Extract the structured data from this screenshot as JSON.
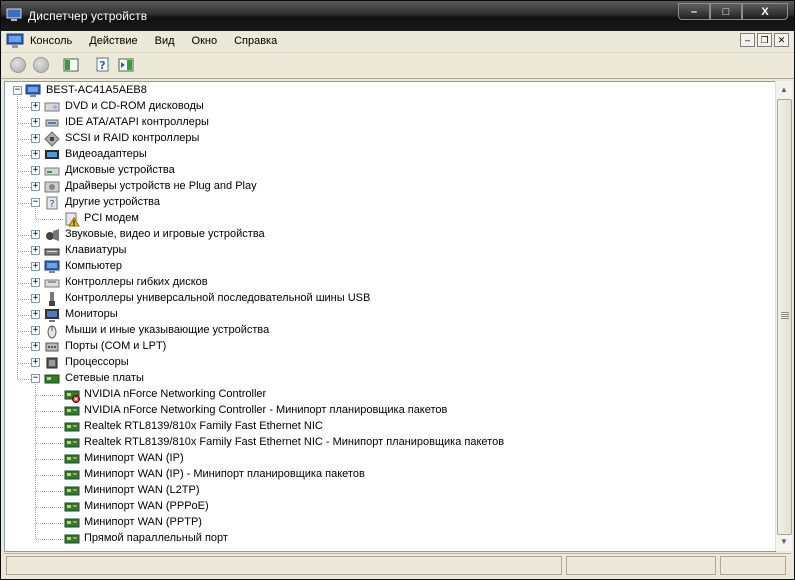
{
  "window": {
    "title": "Диспетчер устройств",
    "buttons": {
      "minimize": "–",
      "maximize": "□",
      "close": "X"
    }
  },
  "menu": {
    "items": [
      "Консоль",
      "Действие",
      "Вид",
      "Окно",
      "Справка"
    ]
  },
  "tree": {
    "root": "BEST-AC41A5AEB8",
    "items": [
      {
        "label": "DVD и CD-ROM дисководы",
        "level": 1,
        "expander": "+",
        "icon": "cdrom-icon"
      },
      {
        "label": "IDE ATA/ATAPI контроллеры",
        "level": 1,
        "expander": "+",
        "icon": "ide-controller-icon"
      },
      {
        "label": "SCSI и RAID контроллеры",
        "level": 1,
        "expander": "+",
        "icon": "scsi-controller-icon"
      },
      {
        "label": "Видеоадаптеры",
        "level": 1,
        "expander": "+",
        "icon": "display-adapter-icon"
      },
      {
        "label": "Дисковые устройства",
        "level": 1,
        "expander": "+",
        "icon": "disk-drive-icon"
      },
      {
        "label": "Драйверы устройств не Plug and Play",
        "level": 1,
        "expander": "+",
        "icon": "non-pnp-driver-icon"
      },
      {
        "label": "Другие устройства",
        "level": 1,
        "expander": "−",
        "icon": "other-devices-icon"
      },
      {
        "label": "PCI модем",
        "level": 2,
        "expander": "",
        "icon": "warning-device-icon"
      },
      {
        "label": "Звуковые, видео и игровые устройства",
        "level": 1,
        "expander": "+",
        "icon": "sound-device-icon"
      },
      {
        "label": "Клавиатуры",
        "level": 1,
        "expander": "+",
        "icon": "keyboard-icon"
      },
      {
        "label": "Компьютер",
        "level": 1,
        "expander": "+",
        "icon": "computer-icon"
      },
      {
        "label": "Контроллеры гибких дисков",
        "level": 1,
        "expander": "+",
        "icon": "floppy-controller-icon"
      },
      {
        "label": "Контроллеры универсальной последовательной шины USB",
        "level": 1,
        "expander": "+",
        "icon": "usb-icon"
      },
      {
        "label": "Мониторы",
        "level": 1,
        "expander": "+",
        "icon": "monitor-icon"
      },
      {
        "label": "Мыши и иные указывающие устройства",
        "level": 1,
        "expander": "+",
        "icon": "mouse-icon"
      },
      {
        "label": "Порты (COM и LPT)",
        "level": 1,
        "expander": "+",
        "icon": "port-icon"
      },
      {
        "label": "Процессоры",
        "level": 1,
        "expander": "+",
        "icon": "processor-icon"
      },
      {
        "label": "Сетевые платы",
        "level": 1,
        "expander": "−",
        "icon": "network-adapter-icon"
      },
      {
        "label": "NVIDIA nForce Networking Controller",
        "level": 2,
        "expander": "",
        "icon": "disabled-network-card-icon"
      },
      {
        "label": "NVIDIA nForce Networking Controller - Минипорт планировщика пакетов",
        "level": 2,
        "expander": "",
        "icon": "network-card-icon"
      },
      {
        "label": "Realtek RTL8139/810x Family Fast Ethernet NIC",
        "level": 2,
        "expander": "",
        "icon": "network-card-icon"
      },
      {
        "label": "Realtek RTL8139/810x Family Fast Ethernet NIC - Минипорт планировщика пакетов",
        "level": 2,
        "expander": "",
        "icon": "network-card-icon"
      },
      {
        "label": "Минипорт WAN (IP)",
        "level": 2,
        "expander": "",
        "icon": "network-card-icon"
      },
      {
        "label": "Минипорт WAN (IP) - Минипорт планировщика пакетов",
        "level": 2,
        "expander": "",
        "icon": "network-card-icon"
      },
      {
        "label": "Минипорт WAN (L2TP)",
        "level": 2,
        "expander": "",
        "icon": "network-card-icon"
      },
      {
        "label": "Минипорт WAN (PPPoE)",
        "level": 2,
        "expander": "",
        "icon": "network-card-icon"
      },
      {
        "label": "Минипорт WAN (PPTP)",
        "level": 2,
        "expander": "",
        "icon": "network-card-icon"
      },
      {
        "label": "Прямой параллельный порт",
        "level": 2,
        "expander": "",
        "icon": "network-card-icon"
      }
    ]
  },
  "colors": {
    "tree_lines": "#a0a0a0",
    "network_card": "#2f7a2f",
    "warning": "#f2c200",
    "error": "#d0201e"
  }
}
